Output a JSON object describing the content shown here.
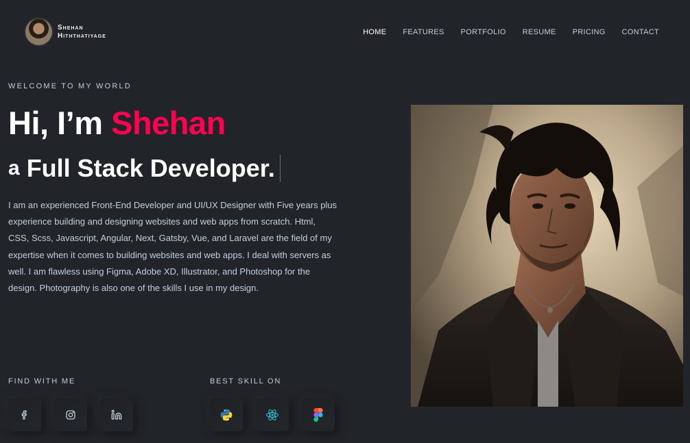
{
  "brand": {
    "name_line1": "Shehan",
    "name_line2": "Hiththatiyage"
  },
  "nav": {
    "items": [
      {
        "label": "HOME",
        "active": true
      },
      {
        "label": "FEATURES",
        "active": false
      },
      {
        "label": "PORTFOLIO",
        "active": false
      },
      {
        "label": "RESUME",
        "active": false
      },
      {
        "label": "PRICING",
        "active": false
      },
      {
        "label": "CONTACT",
        "active": false
      }
    ]
  },
  "hero": {
    "welcome": "WELCOME TO MY WORLD",
    "greeting": "Hi, I’m ",
    "name": "Shehan",
    "role_prefix": "a",
    "role": "Full Stack Developer.",
    "intro": "I am an experienced Front-End Developer and UI/UX Designer with Five years plus experience building and designing websites and web apps from scratch. Html, CSS, Scss, Javascript, Angular, Next, Gatsby, Vue, and Laravel are the field of my expertise when it comes to building websites and web apps. I deal with servers as well. I am flawless using Figma, Adobe XD, Illustrator, and Photoshop for the design. Photography is also one of the skills I use in my design."
  },
  "find": {
    "label": "FIND WITH ME",
    "icons": [
      "facebook-icon",
      "instagram-icon",
      "linkedin-icon"
    ]
  },
  "skills": {
    "label": "BEST SKILL ON",
    "icons": [
      "python-icon",
      "react-icon",
      "figma-icon"
    ]
  },
  "colors": {
    "background": "#212428",
    "accent": "#ff014f",
    "text": "#c4cfde",
    "heading": "#ffffff"
  }
}
